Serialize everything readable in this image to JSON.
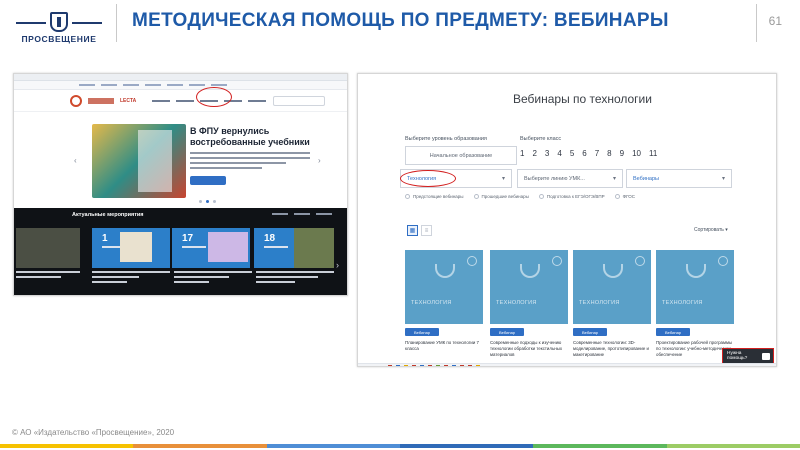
{
  "header": {
    "logo_text": "ПРОСВЕЩЕНИЕ",
    "title": "МЕТОДИЧЕСКАЯ ПОМОЩЬ ПО ПРЕДМЕТУ: ВЕБИНАРЫ",
    "page_number": "61"
  },
  "footer": {
    "copyright": "© АО «Издательство «Просвещение», 2020",
    "stripe_colors": [
      "#f6c200",
      "#e8903a",
      "#4f8ed6",
      "#2f6bb8",
      "#5cb85c",
      "#9ccc65"
    ]
  },
  "left_shot": {
    "brand_lecta": "LECTA",
    "hero_title": "В ФПУ вернулись востребованные учебники",
    "events_title": "Актуальные мероприятия",
    "cards": [
      {
        "num": "1",
        "color": "#2c7fc9"
      },
      {
        "num": "17",
        "color": "#2c7fc9"
      },
      {
        "num": "18",
        "color": "#2c7fc9"
      }
    ]
  },
  "right_shot": {
    "title": "Вебинары по технологии",
    "level_label": "Выберите уровень образования",
    "level_value": "Начальное образование",
    "grade_label": "Выберите класс",
    "grades": [
      "1",
      "2",
      "3",
      "4",
      "5",
      "6",
      "7",
      "8",
      "9",
      "10",
      "11"
    ],
    "subject_value": "Технология",
    "umk_value": "Выберите линию УМК...",
    "type_value": "Вебинары",
    "checks": [
      "Предстоящие вебинары",
      "Прошедшие вебинары",
      "Подготовка к ЕГЭ/ОГЭ/ВПР",
      "ФГОС"
    ],
    "sort_label": "Сортировать",
    "cards": [
      {
        "label": "ТЕХНОЛОГИЯ",
        "tag": "Вебинар",
        "text": "Планирование УМК по технологии 7 класса"
      },
      {
        "label": "ТЕХНОЛОГИЯ",
        "tag": "Вебинар",
        "text": "Современные подходы к изучению технологии обработки текстильных материалов"
      },
      {
        "label": "ТЕХНОЛОГИЯ",
        "tag": "Вебинар",
        "text": "Современные технологии: 3D-моделирование, прототипирование и макетирование"
      },
      {
        "label": "ТЕХНОЛОГИЯ",
        "tag": "Вебинар",
        "text": "Проектирование рабочей программы по технологии: учебно-методическое обеспечение"
      }
    ],
    "help_label": "Нужна помощь?",
    "card_color": "#5aa0c8",
    "highlight_color": "#d21f1f"
  }
}
